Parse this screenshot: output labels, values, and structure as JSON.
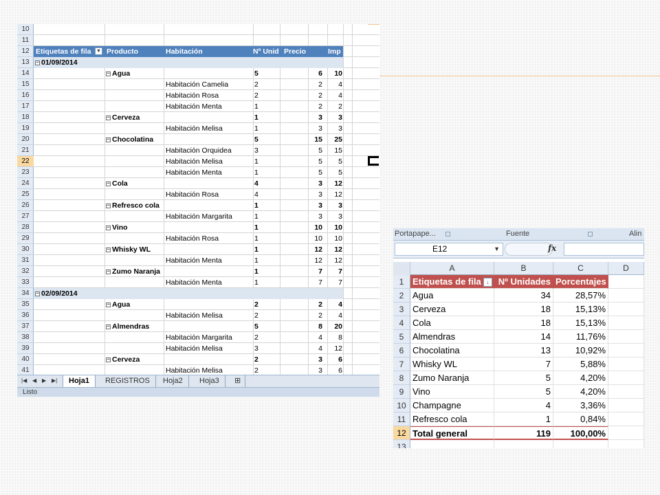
{
  "left_sheet": {
    "header_row": "12",
    "headers": {
      "etiquetas": "Etiquetas de fila",
      "producto": "Producto",
      "habitacion": "Habitación",
      "unid": "Nº Unid",
      "precio": "Precio",
      "imp": "Imp"
    },
    "rows": [
      {
        "n": "10",
        "type": "blank"
      },
      {
        "n": "11",
        "type": "blank"
      },
      {
        "n": "12",
        "type": "header"
      },
      {
        "n": "13",
        "type": "date",
        "label": "01/09/2014"
      },
      {
        "n": "14",
        "type": "product",
        "label": "Agua",
        "u": "5",
        "p": "6",
        "i": "10"
      },
      {
        "n": "15",
        "type": "room",
        "label": "Habitación Camelia",
        "u": "2",
        "p": "2",
        "i": "4"
      },
      {
        "n": "16",
        "type": "room",
        "label": "Habitación Rosa",
        "u": "2",
        "p": "2",
        "i": "4"
      },
      {
        "n": "17",
        "type": "room",
        "label": "Habitación Menta",
        "u": "1",
        "p": "2",
        "i": "2"
      },
      {
        "n": "18",
        "type": "product",
        "label": "Cerveza",
        "u": "1",
        "p": "3",
        "i": "3"
      },
      {
        "n": "19",
        "type": "room",
        "label": "Habitación Melisa",
        "u": "1",
        "p": "3",
        "i": "3"
      },
      {
        "n": "20",
        "type": "product",
        "label": "Chocolatina",
        "u": "5",
        "p": "15",
        "i": "25"
      },
      {
        "n": "21",
        "type": "room",
        "label": "Habitación Orquidea",
        "u": "3",
        "p": "5",
        "i": "15"
      },
      {
        "n": "22",
        "type": "room",
        "label": "Habitación Melisa",
        "u": "1",
        "p": "5",
        "i": "5",
        "selected": true
      },
      {
        "n": "23",
        "type": "room",
        "label": "Habitación Menta",
        "u": "1",
        "p": "5",
        "i": "5"
      },
      {
        "n": "24",
        "type": "product",
        "label": "Cola",
        "u": "4",
        "p": "3",
        "i": "12"
      },
      {
        "n": "25",
        "type": "room",
        "label": "Habitación Rosa",
        "u": "4",
        "p": "3",
        "i": "12"
      },
      {
        "n": "26",
        "type": "product",
        "label": "Refresco cola",
        "u": "1",
        "p": "3",
        "i": "3"
      },
      {
        "n": "27",
        "type": "room",
        "label": "Habitación Margarita",
        "u": "1",
        "p": "3",
        "i": "3"
      },
      {
        "n": "28",
        "type": "product",
        "label": "Vino",
        "u": "1",
        "p": "10",
        "i": "10"
      },
      {
        "n": "29",
        "type": "room",
        "label": "Habitación Rosa",
        "u": "1",
        "p": "10",
        "i": "10"
      },
      {
        "n": "30",
        "type": "product",
        "label": "Whisky WL",
        "u": "1",
        "p": "12",
        "i": "12"
      },
      {
        "n": "31",
        "type": "room",
        "label": "Habitación Menta",
        "u": "1",
        "p": "12",
        "i": "12"
      },
      {
        "n": "32",
        "type": "product",
        "label": "Zumo Naranja",
        "u": "1",
        "p": "7",
        "i": "7"
      },
      {
        "n": "33",
        "type": "room",
        "label": "Habitación Menta",
        "u": "1",
        "p": "7",
        "i": "7"
      },
      {
        "n": "34",
        "type": "date",
        "label": "02/09/2014"
      },
      {
        "n": "35",
        "type": "product",
        "label": "Agua",
        "u": "2",
        "p": "2",
        "i": "4"
      },
      {
        "n": "36",
        "type": "room",
        "label": "Habitación Melisa",
        "u": "2",
        "p": "2",
        "i": "4"
      },
      {
        "n": "37",
        "type": "product",
        "label": "Almendras",
        "u": "5",
        "p": "8",
        "i": "20"
      },
      {
        "n": "38",
        "type": "room",
        "label": "Habitación Margarita",
        "u": "2",
        "p": "4",
        "i": "8"
      },
      {
        "n": "39",
        "type": "room",
        "label": "Habitación Melisa",
        "u": "3",
        "p": "4",
        "i": "12"
      },
      {
        "n": "40",
        "type": "product",
        "label": "Cerveza",
        "u": "2",
        "p": "3",
        "i": "6"
      },
      {
        "n": "41",
        "type": "room",
        "label": "Habitación Melisa",
        "u": "2",
        "p": "3",
        "i": "6"
      }
    ],
    "tabs": [
      "Hoja1",
      "REGISTROS",
      "Hoja2",
      "Hoja3"
    ],
    "status": "Listo"
  },
  "right_sheet": {
    "ribbon_groups": [
      "Portapape...",
      "Fuente",
      "Alin"
    ],
    "name_box": "E12",
    "fx": "fx",
    "columns": [
      "A",
      "B",
      "C",
      "D"
    ],
    "rows": [
      {
        "n": "1",
        "a": "Etiquetas de fila",
        "b": "Nº Unidades",
        "c": "Porcentajes",
        "header": true
      },
      {
        "n": "2",
        "a": "Agua",
        "b": "34",
        "c": "28,57%"
      },
      {
        "n": "3",
        "a": "Cerveza",
        "b": "18",
        "c": "15,13%"
      },
      {
        "n": "4",
        "a": "Cola",
        "b": "18",
        "c": "15,13%"
      },
      {
        "n": "5",
        "a": "Almendras",
        "b": "14",
        "c": "11,76%"
      },
      {
        "n": "6",
        "a": "Chocolatina",
        "b": "13",
        "c": "10,92%"
      },
      {
        "n": "7",
        "a": "Whisky WL",
        "b": "7",
        "c": "5,88%"
      },
      {
        "n": "8",
        "a": "Zumo Naranja",
        "b": "5",
        "c": "4,20%"
      },
      {
        "n": "9",
        "a": "Vino",
        "b": "5",
        "c": "4,20%"
      },
      {
        "n": "10",
        "a": "Champagne",
        "b": "4",
        "c": "3,36%"
      },
      {
        "n": "11",
        "a": "Refresco cola",
        "b": "1",
        "c": "0,84%"
      },
      {
        "n": "12",
        "a": "Total general",
        "b": "119",
        "c": "100,00%",
        "total": true,
        "selected": true
      },
      {
        "n": "13",
        "a": "",
        "b": "",
        "c": ""
      }
    ]
  },
  "colors": {
    "pivot_header_blue": "#4f81bd",
    "date_row_blue": "#dce6f1",
    "pivot_header_red": "#c0504d",
    "selected_row_header": "#f9d99f",
    "accent_orange": "#f4c58a"
  }
}
